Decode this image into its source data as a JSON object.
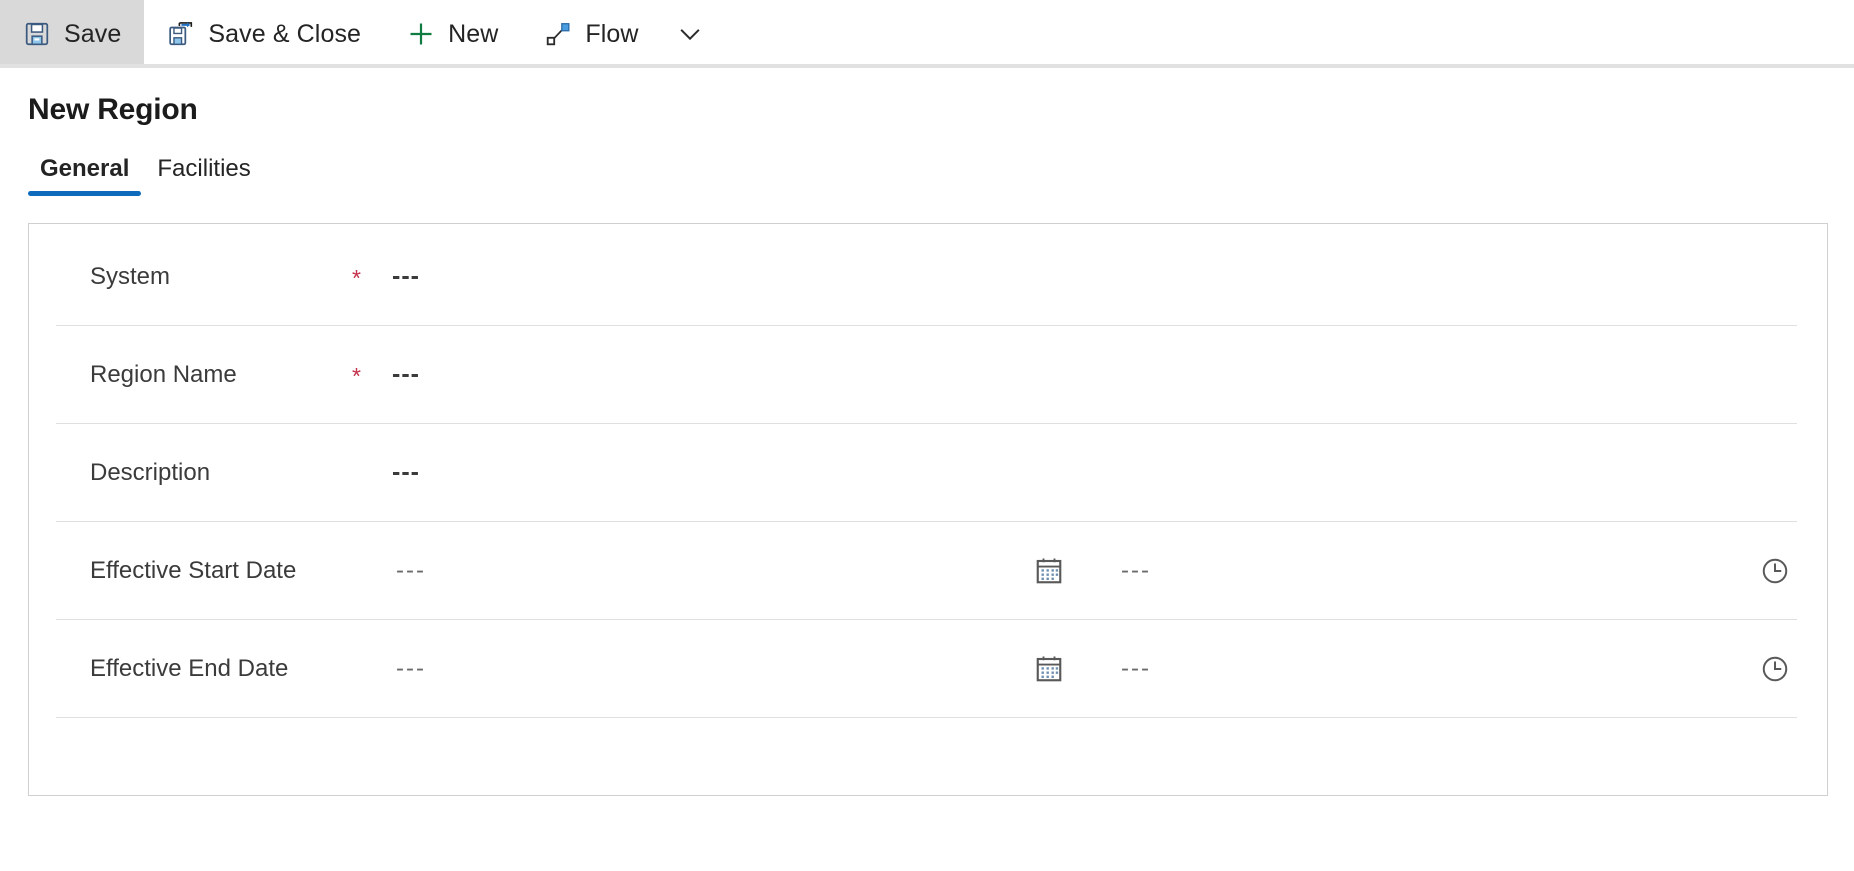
{
  "commandbar": {
    "items": [
      {
        "label": "Save",
        "icon": "save-icon",
        "selected": true
      },
      {
        "label": "Save & Close",
        "icon": "save-close-icon",
        "selected": false
      },
      {
        "label": "New",
        "icon": "plus-icon",
        "selected": false
      },
      {
        "label": "Flow",
        "icon": "flow-icon",
        "selected": false
      }
    ],
    "overflow_icon": "chevron-down-icon"
  },
  "page": {
    "title": "New Region"
  },
  "tabs": [
    {
      "label": "General",
      "active": true
    },
    {
      "label": "Facilities",
      "active": false
    }
  ],
  "form": {
    "rows": [
      {
        "label": "System",
        "required": "*",
        "value": "---",
        "type": "text"
      },
      {
        "label": "Region Name",
        "required": "*",
        "value": "---",
        "type": "text"
      },
      {
        "label": "Description",
        "required": "",
        "value": "---",
        "type": "text"
      },
      {
        "label": "Effective Start Date",
        "required": "",
        "value": "---",
        "time_value": "---",
        "type": "datetime",
        "date_icon": "calendar-icon",
        "time_icon": "clock-icon"
      },
      {
        "label": "Effective End Date",
        "required": "",
        "value": "---",
        "time_value": "---",
        "type": "datetime",
        "date_icon": "calendar-icon",
        "time_icon": "clock-icon"
      }
    ]
  },
  "colors": {
    "accent": "#0f6cbd",
    "required": "#c4314b",
    "new_icon": "#107c41",
    "selected_bg": "#d9d9d9",
    "border": "#cfcfcf"
  }
}
